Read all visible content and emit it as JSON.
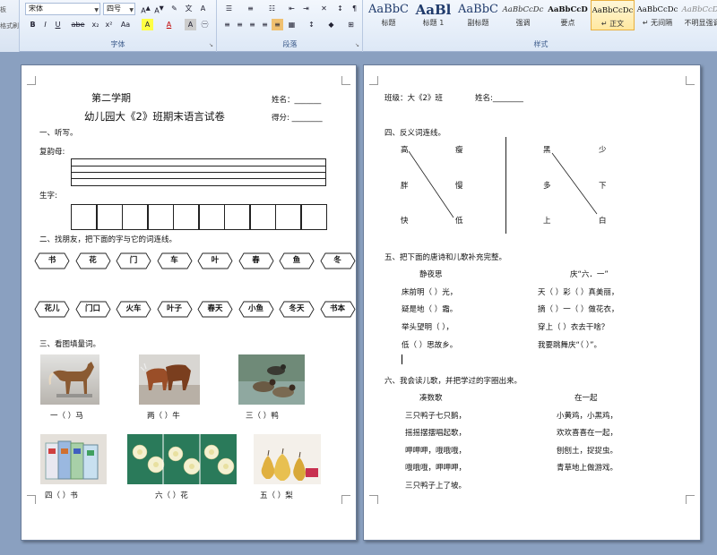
{
  "ribbon": {
    "left_stub": {
      "line1": "板",
      "line2": "格式刷"
    },
    "font": {
      "font_name": "宋体",
      "font_size": "四号",
      "group_label": "字体",
      "buttons": [
        "B",
        "I",
        "U",
        "abe",
        "x₂",
        "x²",
        "Aa",
        "A",
        "A",
        "A",
        "㊀"
      ]
    },
    "paragraph": {
      "group_label": "段落"
    },
    "styles": {
      "group_label": "样式",
      "items": [
        {
          "sample": "AaBbC",
          "name": "标题"
        },
        {
          "sample": "AaBl",
          "name": "标题 1"
        },
        {
          "sample": "AaBbC",
          "name": "副标题"
        },
        {
          "sample": "AaBbCcDc",
          "name": "强调"
        },
        {
          "sample": "AaBbCcD",
          "name": "要点"
        },
        {
          "sample": "AaBbCcDc",
          "name": "↵ 正文"
        },
        {
          "sample": "AaBbCcDc",
          "name": "↵ 无间隔"
        },
        {
          "sample": "AaBbCcDc",
          "name": "不明显强调"
        }
      ]
    }
  },
  "page1": {
    "semester": "第二学期",
    "title": "幼儿园大《2》班期末语言试卷",
    "name_label": "姓名：_______",
    "score_label": "得分:  ________",
    "sec1": "一、听写。",
    "fuyunmu": "复韵母:",
    "shengzi": "生字:",
    "sec2": "二、找朋友，把下面的字与它的词连线。",
    "chars": [
      "书",
      "花",
      "门",
      "车",
      "叶",
      "春",
      "鱼",
      "冬"
    ],
    "words": [
      "花儿",
      "门口",
      "火车",
      "叶子",
      "春天",
      "小鱼",
      "冬天",
      "书本"
    ],
    "sec3": "三、看图填量词。",
    "pictures": [
      {
        "caption": "一（    ）马",
        "icon": "horse-photo"
      },
      {
        "caption": "两（    ）牛",
        "icon": "cattle-photo"
      },
      {
        "caption": "三（    ）鸭",
        "icon": "ducks-photo"
      },
      {
        "caption": "四（    ）书",
        "icon": "books-photo"
      },
      {
        "caption": "六（    ）花",
        "icon": "flowers-photo"
      },
      {
        "caption": "五（    ）梨",
        "icon": "pears-photo"
      }
    ]
  },
  "page2": {
    "class_label": "班级：大《2》班",
    "name_label": "姓名:________",
    "sec4": "四、反义词连线。",
    "antonyms_left_col1": [
      "高",
      "胖",
      "快"
    ],
    "antonyms_left_col2": [
      "瘦",
      "慢",
      "低"
    ],
    "antonyms_right_col1": [
      "黑",
      "多",
      "上"
    ],
    "antonyms_right_col2": [
      "少",
      "下",
      "白"
    ],
    "sec5": "五、把下面的唐诗和儿歌补充完整。",
    "poem_title": "静夜思",
    "poem_lines": [
      "床前明（    ）光，",
      "疑是地（    ）霜。",
      "举头望明（    ），",
      "低（    ）思故乡。"
    ],
    "song_title": "庆“六．一”",
    "song_lines": [
      "天（    ）彩（    ）真美丽，",
      "摘（    ）一（    ）做花衣，",
      "穿上（    ）衣去干啥？",
      "我要跳舞庆“（          ）”。"
    ],
    "sec6": "六、我会读儿歌，并把学过的字圈出来。",
    "rhyme1_title": "凑数歌",
    "rhyme1_lines": [
      "三只鸭子七只鹅，",
      "摇摇摆摆唱起歌，",
      "呷呷呷，哦哦哦，",
      "哦哦哦，呷呷呷，",
      "三只鸭子上了坡。"
    ],
    "rhyme2_title": "在一起",
    "rhyme2_lines": [
      "小黄鸡，小黑鸡，",
      "欢欢喜喜在一起，",
      "刨刨土，捉捉虫。",
      "青草地上做游戏。"
    ]
  },
  "colors": {
    "ribbon_bg": "#dde8f6",
    "workspace": "#8aa0c0",
    "accent": "#3a5a8a"
  }
}
